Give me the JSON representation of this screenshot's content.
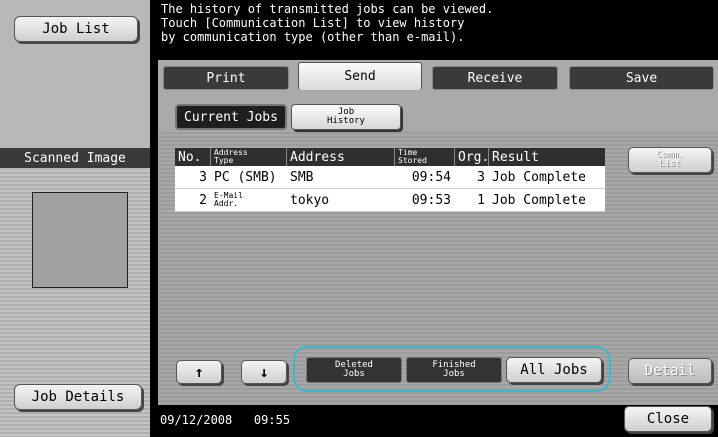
{
  "left_panel": {
    "job_list_label": "Job List",
    "scanned_image_label": "Scanned Image",
    "job_details_label": "Job Details"
  },
  "message": "The history of transmitted jobs can be viewed.\nTouch [Communication List] to view history\nby communication type (other than e-mail).",
  "tabs": [
    {
      "label": "Print",
      "active": false
    },
    {
      "label": "Send",
      "active": true
    },
    {
      "label": "Receive",
      "active": false
    },
    {
      "label": "Save",
      "active": false
    }
  ],
  "sub_tabs": {
    "current_jobs": "Current Jobs",
    "job_history_line1": "Job",
    "job_history_line2": "History"
  },
  "table": {
    "headers": {
      "no": "No.",
      "address_type_1": "Address",
      "address_type_2": "Type",
      "address": "Address",
      "time_stored_1": "Time",
      "time_stored_2": "Stored",
      "org": "Org.",
      "result": "Result"
    },
    "rows": [
      {
        "no": "3",
        "address_type": "PC (SMB)",
        "address_type_2": "",
        "address": "SMB",
        "time": "09:54",
        "org": "3",
        "result": "Job Complete"
      },
      {
        "no": "2",
        "address_type": "E-Mail",
        "address_type_2": "Addr.",
        "address": "tokyo",
        "time": "09:53",
        "org": "1",
        "result": "Job Complete"
      }
    ]
  },
  "right": {
    "comm_list_1": "Comm.",
    "comm_list_2": "List",
    "detail_label": "Detail"
  },
  "bottom": {
    "up_arrow": "↑",
    "down_arrow": "↓",
    "deleted_1": "Deleted",
    "deleted_2": "Jobs",
    "finished_1": "Finished",
    "finished_2": "Jobs",
    "all_jobs": "All Jobs"
  },
  "footer": {
    "datetime": "09/12/2008   09:55",
    "close_label": "Close"
  },
  "colors": {
    "highlight": "#39b9c6"
  }
}
